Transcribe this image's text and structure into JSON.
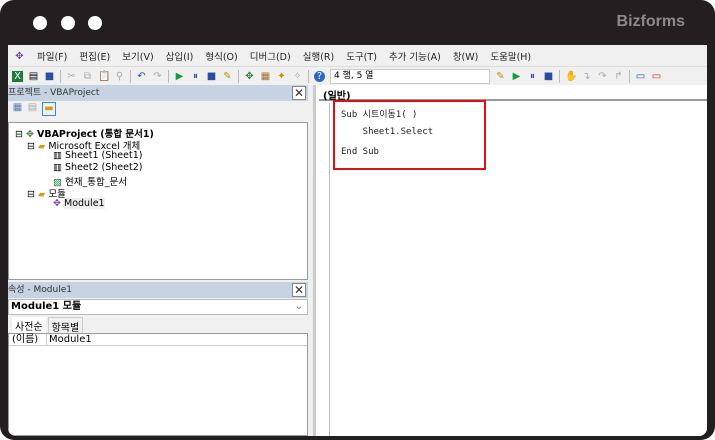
{
  "brand": "Bizforms",
  "menu": [
    "파일(F)",
    "편집(E)",
    "보기(V)",
    "삽입(I)",
    "형식(O)",
    "디버그(D)",
    "실행(R)",
    "도구(T)",
    "추가 기능(A)",
    "창(W)",
    "도움말(H)"
  ],
  "toolbar": {
    "position": "4 행, 5 열"
  },
  "project": {
    "title": "프로젝트 - VBAProject",
    "root": "VBAProject (통합 문서1)",
    "excel_folder": "Microsoft Excel 개체",
    "sheet1": "Sheet1 (Sheet1)",
    "sheet2": "Sheet2 (Sheet2)",
    "workbook": "현재_통합_문서",
    "modules_folder": "모듈",
    "module1": "Module1"
  },
  "properties": {
    "title": "속성 - Module1",
    "object": "Module1 모듈",
    "tabs": [
      "사전순",
      "항목별"
    ],
    "rows": [
      {
        "name": "(이름)",
        "value": "Module1"
      }
    ]
  },
  "code": {
    "combo": "(일반)",
    "lines": [
      "Sub 시트이동1( )",
      "    Sheet1.Select",
      "End Sub"
    ],
    "highlight_color": "#e01010"
  }
}
